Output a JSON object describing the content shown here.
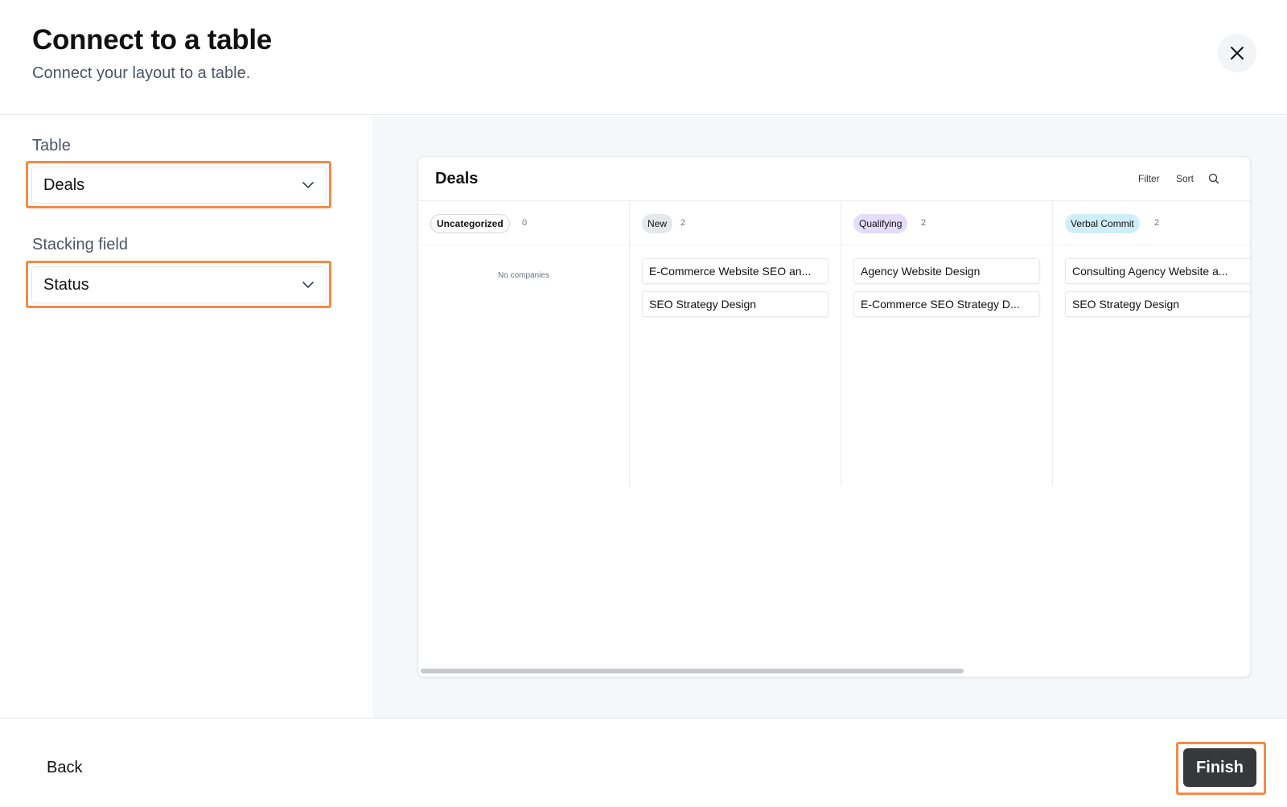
{
  "dialog": {
    "title": "Connect to a table",
    "subtitle": "Connect your layout to a table."
  },
  "form": {
    "table_label": "Table",
    "table_value": "Deals",
    "stacking_label": "Stacking field",
    "stacking_value": "Status"
  },
  "preview": {
    "title": "Deals",
    "filter_label": "Filter",
    "sort_label": "Sort",
    "columns": [
      {
        "name": "Uncategorized",
        "count": "0",
        "badge_color": "#ffffff",
        "badge_border": "#d1d5db",
        "empty_text": "No companies",
        "cards": []
      },
      {
        "name": "New",
        "count": "2",
        "badge_color": "#e5e7eb",
        "cards": [
          "E-Commerce Website SEO an...",
          "SEO Strategy Design"
        ]
      },
      {
        "name": "Qualifying",
        "count": "2",
        "badge_color": "#e3dcfb",
        "cards": [
          "Agency Website Design",
          "E-Commerce SEO Strategy D..."
        ]
      },
      {
        "name": "Verbal Commit",
        "count": "2",
        "badge_color": "#cfeefa",
        "cards": [
          "Consulting Agency Website a...",
          "SEO Strategy Design"
        ]
      }
    ]
  },
  "footer": {
    "back_label": "Back",
    "finish_label": "Finish"
  },
  "colors": {
    "highlight": "#f58a46",
    "finish_bg": "#36383c"
  }
}
